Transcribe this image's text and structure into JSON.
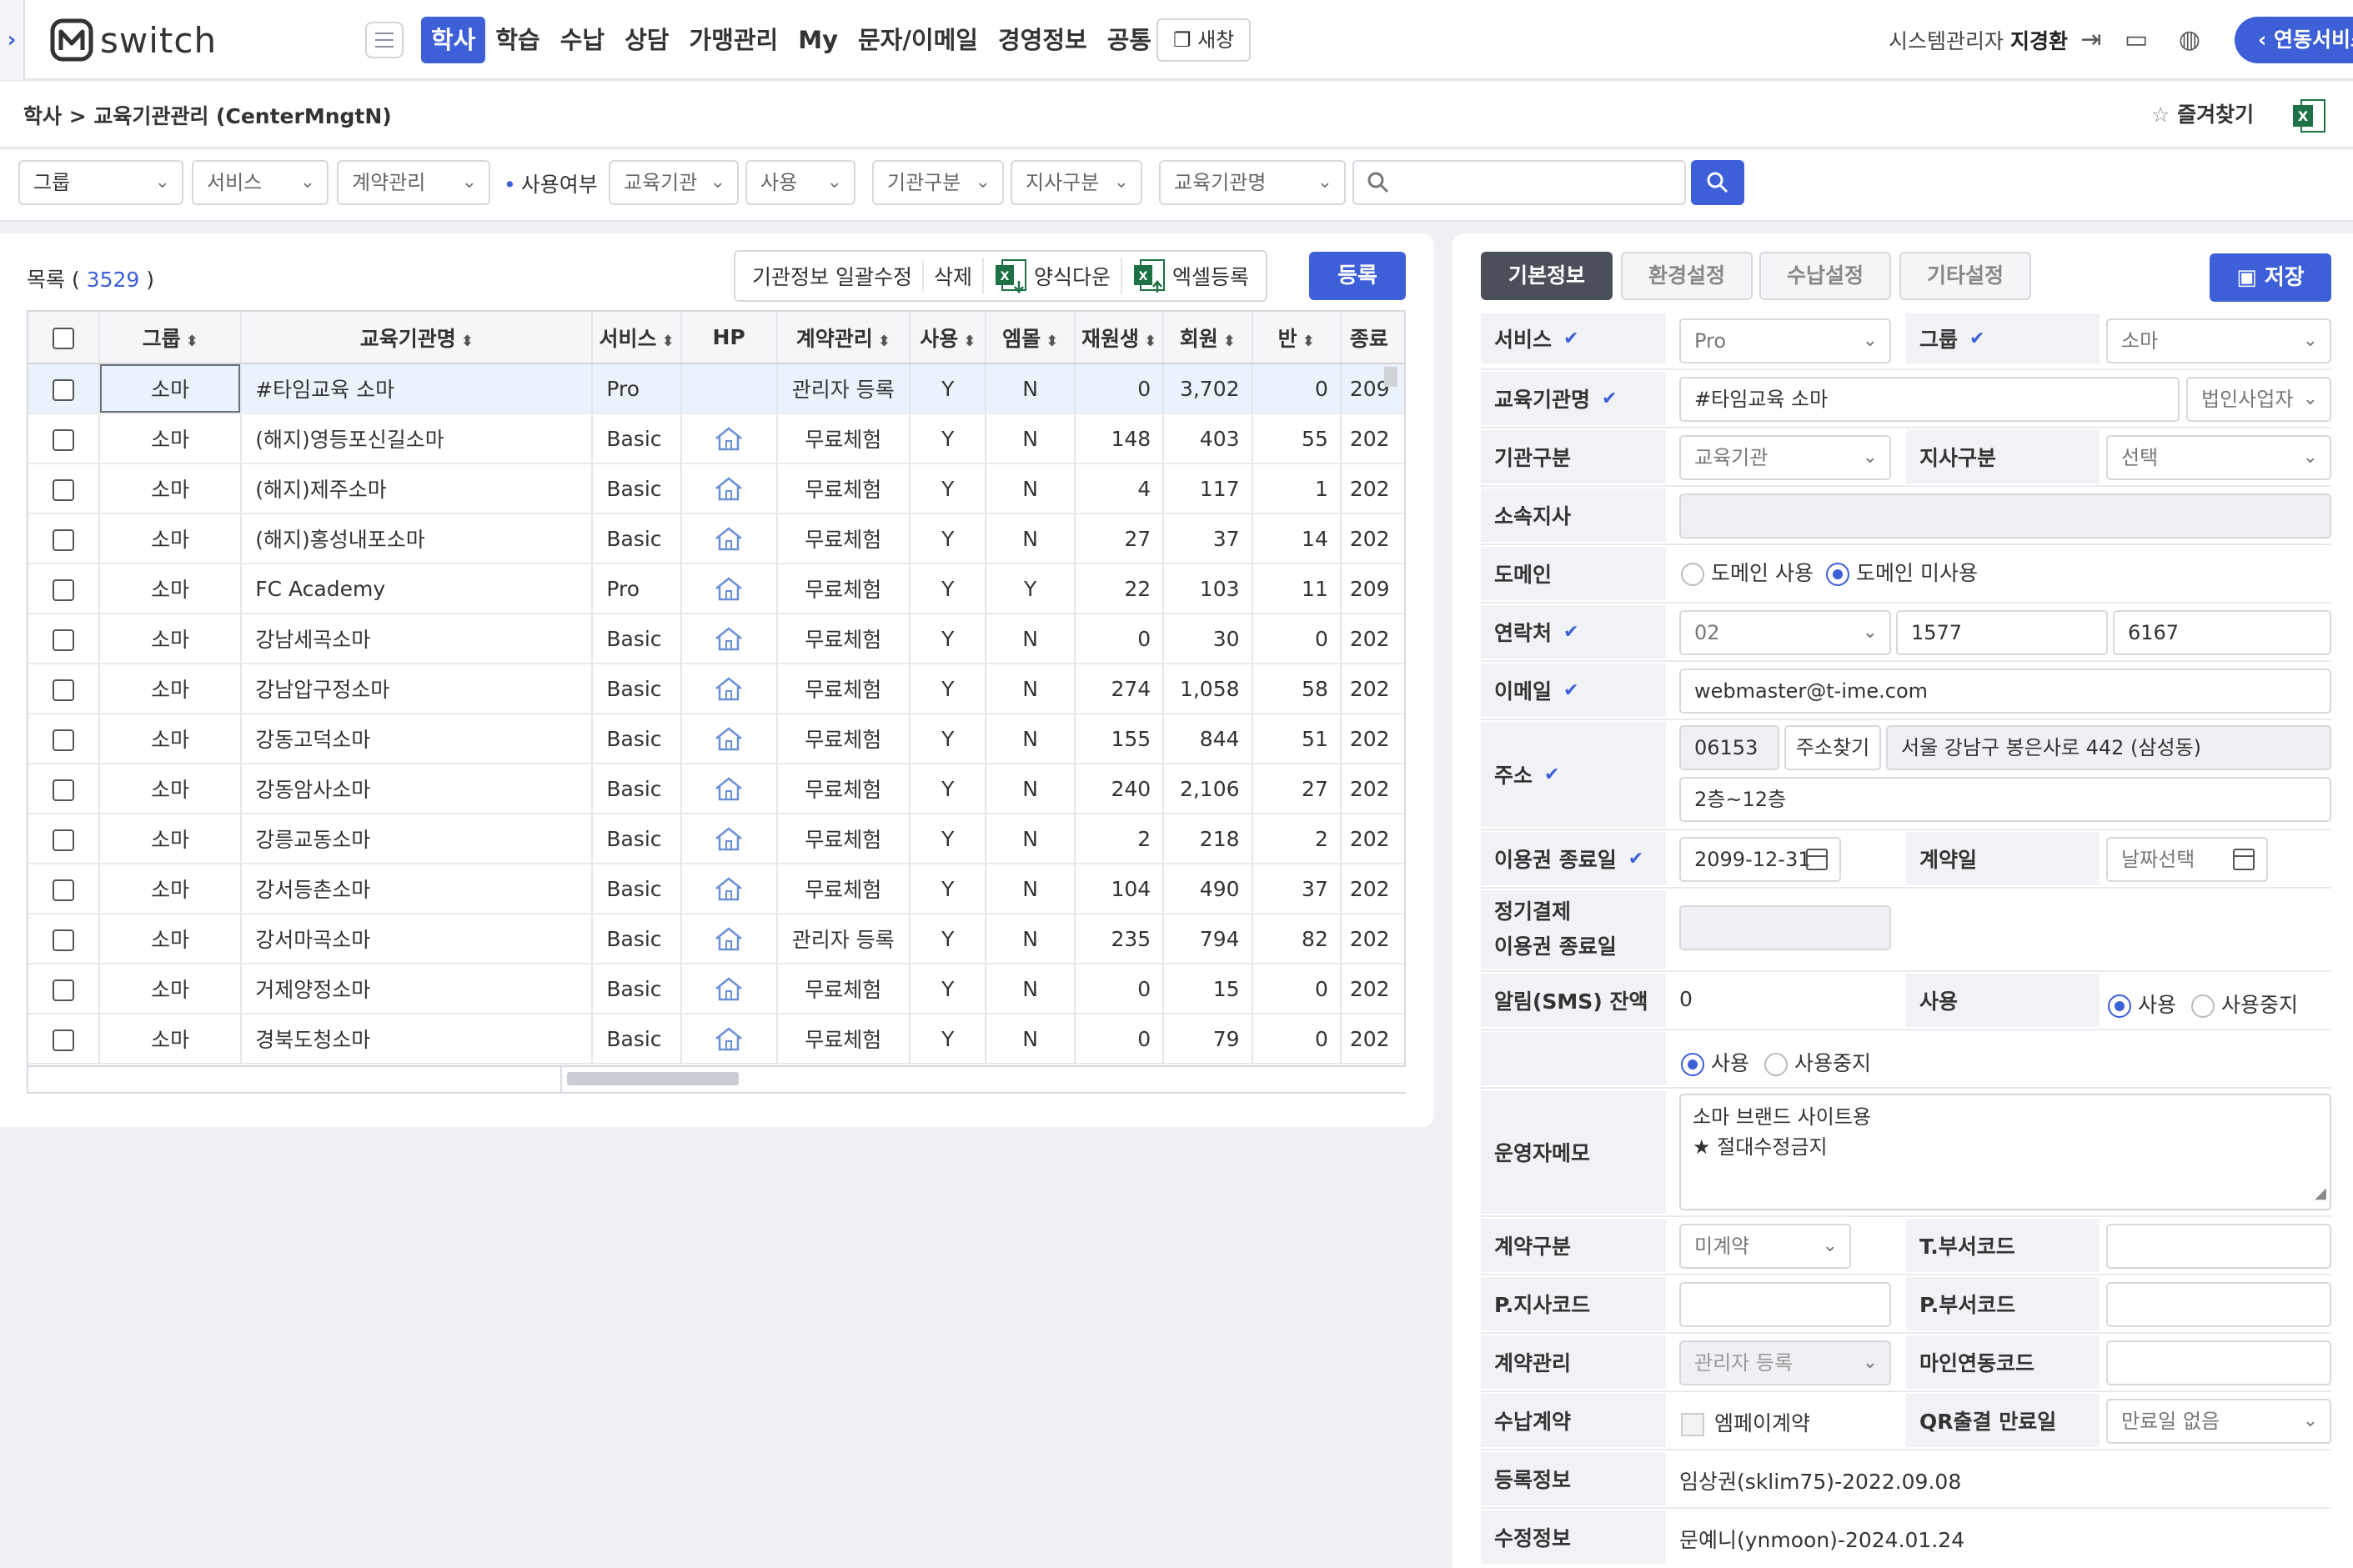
{
  "nav": {
    "logo_text": "switch",
    "menu": [
      "학사",
      "학습",
      "수납",
      "상담",
      "가맹관리",
      "My",
      "문자/이메일",
      "경영정보",
      "공통"
    ],
    "new_window": "새창",
    "user_role": "시스템관리자",
    "user_name": "지경환",
    "link_service": "연동서비스"
  },
  "breadcrumb": "학사 > 교육기관관리 (CenterMngtN)",
  "favorite_label": "즐겨찾기",
  "filters": {
    "group": "그룹",
    "service": "서비스",
    "contract": "계약관리",
    "usage_label": "사용여부",
    "org_type": "교육기관",
    "usage": "사용",
    "inst_type": "기관구분",
    "branch_type": "지사구분",
    "org_name": "교육기관명",
    "search_value": ""
  },
  "list": {
    "title": "목록",
    "count": "3529",
    "actions": {
      "bulk_edit": "기관정보 일괄수정",
      "delete": "삭제",
      "template_download": "양식다운",
      "excel_upload": "엑셀등록",
      "register": "등록"
    },
    "columns": [
      "그룹",
      "교육기관명",
      "서비스",
      "HP",
      "계약관리",
      "사용",
      "엠몰",
      "재원생",
      "회원",
      "반",
      "종료"
    ],
    "rows": [
      {
        "group": "소마",
        "name": "#타임교육 소마",
        "service": "Pro",
        "hp": false,
        "contract": "관리자 등록",
        "use": "Y",
        "mall": "N",
        "students": "0",
        "members": "3,702",
        "classes": "0",
        "end": "209"
      },
      {
        "group": "소마",
        "name": "(해지)영등포신길소마",
        "service": "Basic",
        "hp": true,
        "contract": "무료체험",
        "use": "Y",
        "mall": "N",
        "students": "148",
        "members": "403",
        "classes": "55",
        "end": "202"
      },
      {
        "group": "소마",
        "name": "(해지)제주소마",
        "service": "Basic",
        "hp": true,
        "contract": "무료체험",
        "use": "Y",
        "mall": "N",
        "students": "4",
        "members": "117",
        "classes": "1",
        "end": "202"
      },
      {
        "group": "소마",
        "name": "(해지)홍성내포소마",
        "service": "Basic",
        "hp": true,
        "contract": "무료체험",
        "use": "Y",
        "mall": "N",
        "students": "27",
        "members": "37",
        "classes": "14",
        "end": "202"
      },
      {
        "group": "소마",
        "name": "FC Academy",
        "service": "Pro",
        "hp": true,
        "contract": "무료체험",
        "use": "Y",
        "mall": "Y",
        "students": "22",
        "members": "103",
        "classes": "11",
        "end": "209"
      },
      {
        "group": "소마",
        "name": "강남세곡소마",
        "service": "Basic",
        "hp": true,
        "contract": "무료체험",
        "use": "Y",
        "mall": "N",
        "students": "0",
        "members": "30",
        "classes": "0",
        "end": "202"
      },
      {
        "group": "소마",
        "name": "강남압구정소마",
        "service": "Basic",
        "hp": true,
        "contract": "무료체험",
        "use": "Y",
        "mall": "N",
        "students": "274",
        "members": "1,058",
        "classes": "58",
        "end": "202"
      },
      {
        "group": "소마",
        "name": "강동고덕소마",
        "service": "Basic",
        "hp": true,
        "contract": "무료체험",
        "use": "Y",
        "mall": "N",
        "students": "155",
        "members": "844",
        "classes": "51",
        "end": "202"
      },
      {
        "group": "소마",
        "name": "강동암사소마",
        "service": "Basic",
        "hp": true,
        "contract": "무료체험",
        "use": "Y",
        "mall": "N",
        "students": "240",
        "members": "2,106",
        "classes": "27",
        "end": "202"
      },
      {
        "group": "소마",
        "name": "강릉교동소마",
        "service": "Basic",
        "hp": true,
        "contract": "무료체험",
        "use": "Y",
        "mall": "N",
        "students": "2",
        "members": "218",
        "classes": "2",
        "end": "202"
      },
      {
        "group": "소마",
        "name": "강서등촌소마",
        "service": "Basic",
        "hp": true,
        "contract": "무료체험",
        "use": "Y",
        "mall": "N",
        "students": "104",
        "members": "490",
        "classes": "37",
        "end": "202"
      },
      {
        "group": "소마",
        "name": "강서마곡소마",
        "service": "Basic",
        "hp": true,
        "contract": "관리자 등록",
        "use": "Y",
        "mall": "N",
        "students": "235",
        "members": "794",
        "classes": "82",
        "end": "202"
      },
      {
        "group": "소마",
        "name": "거제양정소마",
        "service": "Basic",
        "hp": true,
        "contract": "무료체험",
        "use": "Y",
        "mall": "N",
        "students": "0",
        "members": "15",
        "classes": "0",
        "end": "202"
      },
      {
        "group": "소마",
        "name": "경북도청소마",
        "service": "Basic",
        "hp": true,
        "contract": "무료체험",
        "use": "Y",
        "mall": "N",
        "students": "0",
        "members": "79",
        "classes": "0",
        "end": "202"
      }
    ]
  },
  "detail": {
    "tabs": [
      "기본정보",
      "환경설정",
      "수납설정",
      "기타설정"
    ],
    "save": "저장",
    "labels": {
      "service": "서비스",
      "group": "그룹",
      "org_name": "교육기관명",
      "inst_type": "기관구분",
      "branch_type": "지사구분",
      "branch": "소속지사",
      "domain": "도메인",
      "phone": "연락처",
      "email": "이메일",
      "address": "주소",
      "expire": "이용권 종료일",
      "contract_date": "계약일",
      "regular_pay_1": "정기결제",
      "regular_pay_2": "이용권 종료일",
      "sms": "알림(SMS) 잔액",
      "use": "사용",
      "memo": "운영자메모",
      "contract_type": "계약구분",
      "t_dept": "T.부서코드",
      "p_branch": "P.지사코드",
      "p_dept": "P.부서코드",
      "contract_mgmt": "계약관리",
      "mine_code": "마인연동코드",
      "pay_contract": "수납계약",
      "qr_expire": "QR출결 만료일",
      "reg_info": "등록정보",
      "mod_info": "수정정보"
    },
    "values": {
      "service": "Pro",
      "group": "소마",
      "org_name": "#타임교육 소마",
      "biz_type": "법인사업자",
      "inst_type": "교육기관",
      "branch_type": "선택",
      "branch": "",
      "domain_use": "도메인 사용",
      "domain_nouse": "도메인 미사용",
      "phone1": "02",
      "phone2": "1577",
      "phone3": "6167",
      "email": "webmaster@t-ime.com",
      "zip": "06153",
      "addr_search": "주소찾기",
      "addr1": "서울 강남구 봉은사로 442 (삼성동)",
      "addr2": "2층~12층",
      "expire": "2099-12-31",
      "contract_date": "날짜선택",
      "regular_pay": "",
      "sms": "0",
      "use_on": "사용",
      "use_off": "사용중지",
      "use2_on": "사용",
      "use2_off": "사용중지",
      "memo_line1": "소마 브랜드 사이트용",
      "memo_line2": "★ 절대수정금지",
      "contract_type": "미계약",
      "t_dept": "",
      "p_branch": "",
      "p_dept": "",
      "contract_mgmt": "관리자 등록",
      "mine_code": "",
      "pay_contract": "엠페이계약",
      "qr_expire": "만료일 없음",
      "reg_info": "임상권(sklim75)-2022.09.08",
      "mod_info": "문예니(ynmoon)-2024.01.24"
    }
  },
  "colors": {
    "accent": "#3d5fd8",
    "excel_green": "#1e7145"
  }
}
